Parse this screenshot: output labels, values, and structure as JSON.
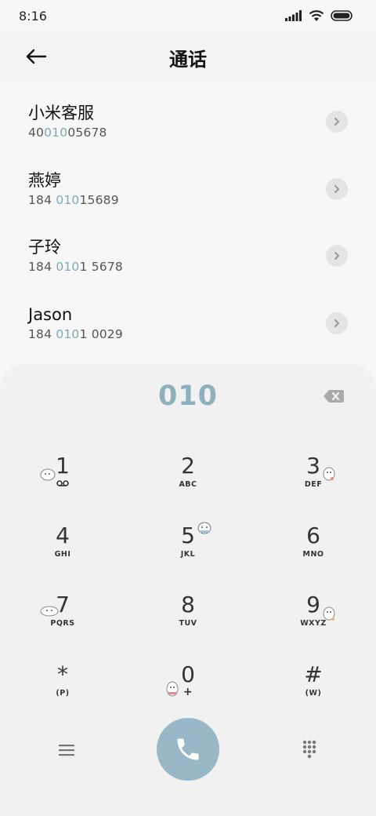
{
  "status_bar": {
    "time": "8:16"
  },
  "header": {
    "title": "通话"
  },
  "contacts": [
    {
      "name": "小米客服",
      "number_pre": "40",
      "number_match": "010",
      "number_post": "05678"
    },
    {
      "name": "燕婷",
      "number_pre": "184 ",
      "number_match": "010",
      "number_post": "15689"
    },
    {
      "name": "子玲",
      "number_pre": "184 ",
      "number_match": "010",
      "number_post": "1 5678"
    },
    {
      "name": "Jason",
      "number_pre": "184 ",
      "number_match": "010",
      "number_post": "1 0029"
    }
  ],
  "dialpad": {
    "input": "010",
    "keys": [
      {
        "digit": "1",
        "letters": ""
      },
      {
        "digit": "2",
        "letters": "ABC"
      },
      {
        "digit": "3",
        "letters": "DEF"
      },
      {
        "digit": "4",
        "letters": "GHI"
      },
      {
        "digit": "5",
        "letters": "JKL"
      },
      {
        "digit": "6",
        "letters": "MNO"
      },
      {
        "digit": "7",
        "letters": "PQRS"
      },
      {
        "digit": "8",
        "letters": "TUV"
      },
      {
        "digit": "9",
        "letters": "WXYZ"
      },
      {
        "digit": "*",
        "letters": "(P)"
      },
      {
        "digit": "0",
        "letters": "+"
      },
      {
        "digit": "#",
        "letters": "(W)"
      }
    ]
  },
  "icons": {
    "back": "arrow-left-icon",
    "chevron": "chevron-right-icon",
    "backspace": "backspace-icon",
    "voicemail": "voicemail-icon",
    "menu": "menu-icon",
    "call": "phone-icon",
    "keypad": "keypad-icon"
  },
  "colors": {
    "accent": "#7fa8b8",
    "call_button": "#99b8c7",
    "dial_input": "#8fb0bf"
  }
}
